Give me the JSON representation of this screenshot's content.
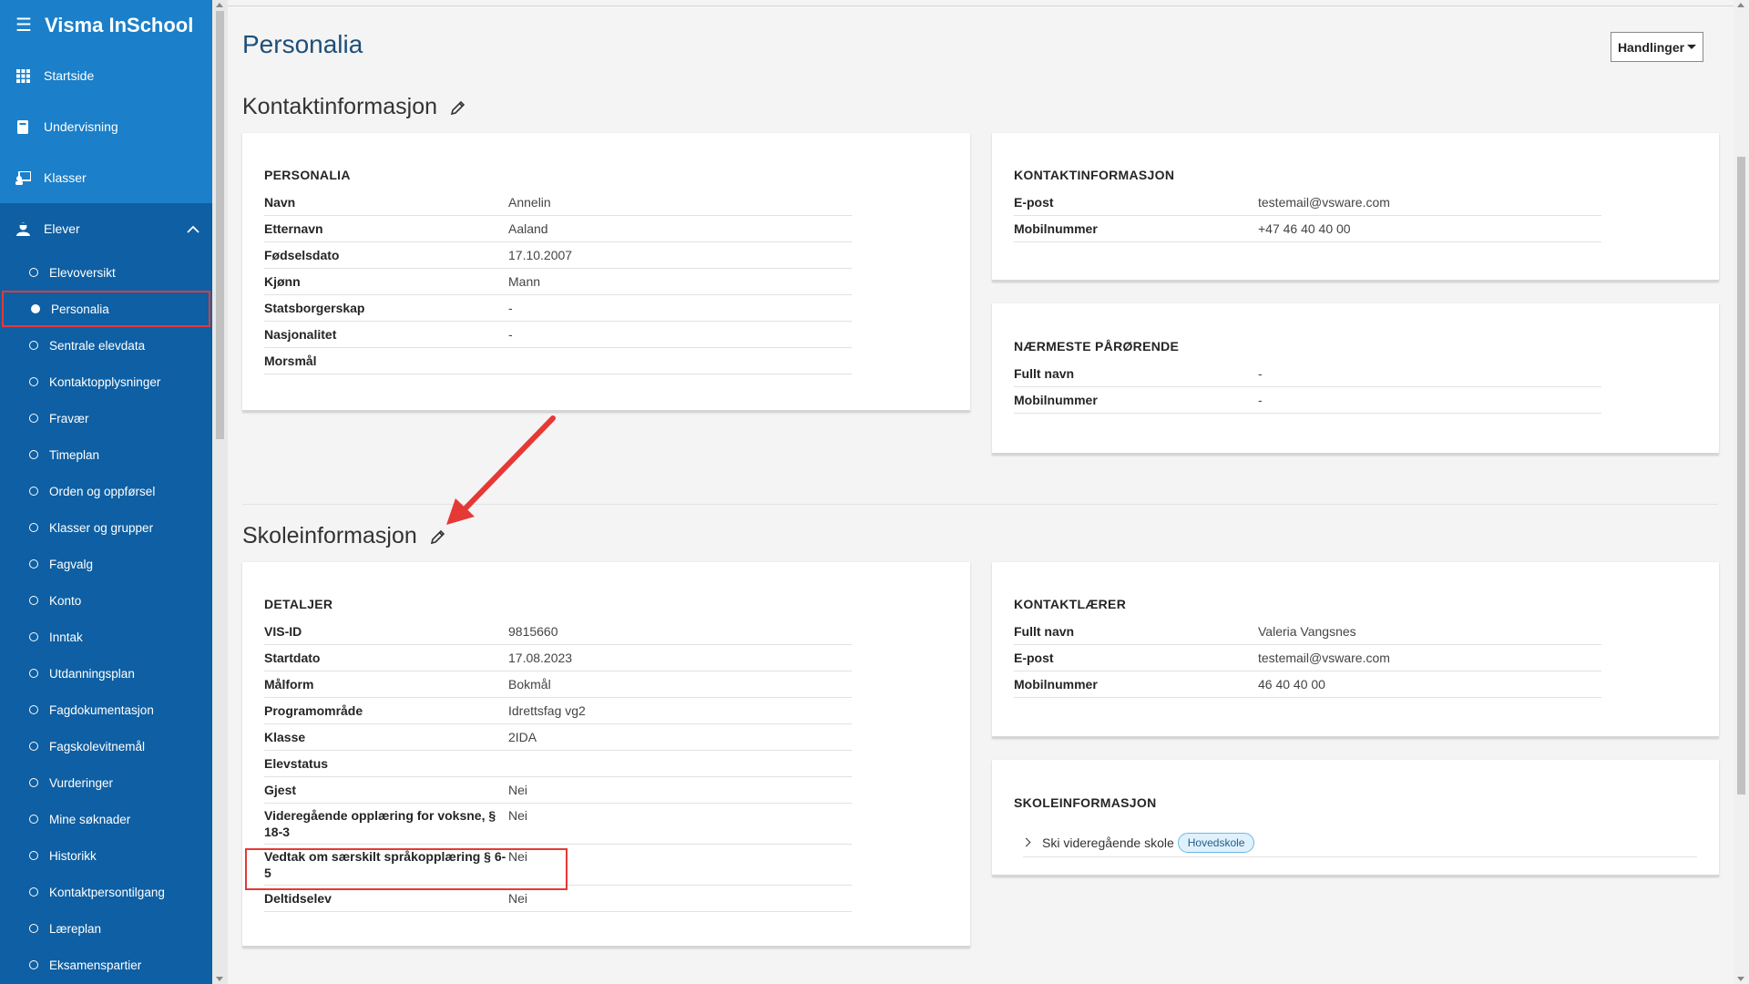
{
  "app": {
    "title": "Visma InSchool"
  },
  "sidebar": {
    "main_items": [
      {
        "label": "Startside",
        "icon": "grid-icon"
      },
      {
        "label": "Undervisning",
        "icon": "book-icon"
      },
      {
        "label": "Klasser",
        "icon": "classroom-icon"
      },
      {
        "label": "Elever",
        "icon": "student-icon"
      }
    ],
    "elever_subitems": [
      "Elevoversikt",
      "Personalia",
      "Sentrale elevdata",
      "Kontaktopplysninger",
      "Fravær",
      "Timeplan",
      "Orden og oppførsel",
      "Klasser og grupper",
      "Fagvalg",
      "Konto",
      "Inntak",
      "Utdanningsplan",
      "Fagdokumentasjon",
      "Fagskolevitnemål",
      "Vurderinger",
      "Mine søknader",
      "Historikk",
      "Kontaktpersontilgang",
      "Læreplan",
      "Eksamenspartier"
    ],
    "active_item": "Personalia"
  },
  "header": {
    "title": "Personalia",
    "actions_label": "Handlinger"
  },
  "kontakt_section": {
    "title": "Kontaktinformasjon",
    "personalia": {
      "heading": "PERSONALIA",
      "rows": [
        {
          "k": "Navn",
          "v": "Annelin"
        },
        {
          "k": "Etternavn",
          "v": "Aaland"
        },
        {
          "k": "Fødselsdato",
          "v": "17.10.2007"
        },
        {
          "k": "Kjønn",
          "v": "Mann"
        },
        {
          "k": "Statsborgerskap",
          "v": "-"
        },
        {
          "k": "Nasjonalitet",
          "v": "-"
        },
        {
          "k": "Morsmål",
          "v": ""
        }
      ]
    },
    "kontaktinfo": {
      "heading": "KONTAKTINFORMASJON",
      "rows": [
        {
          "k": "E-post",
          "v": "testemail@vsware.com"
        },
        {
          "k": "Mobilnummer",
          "v": "+47 46 40 40 00"
        }
      ]
    },
    "parorende": {
      "heading": "NÆRMESTE PÅRØRENDE",
      "rows": [
        {
          "k": "Fullt navn",
          "v": "-"
        },
        {
          "k": "Mobilnummer",
          "v": "-"
        }
      ]
    }
  },
  "skole_section": {
    "title": "Skoleinformasjon",
    "detaljer": {
      "heading": "DETALJER",
      "rows": [
        {
          "k": "VIS-ID",
          "v": "9815660"
        },
        {
          "k": "Startdato",
          "v": "17.08.2023"
        },
        {
          "k": "Målform",
          "v": "Bokmål"
        },
        {
          "k": "Programområde",
          "v": "Idrettsfag vg2"
        },
        {
          "k": "Klasse",
          "v": "2IDA"
        },
        {
          "k": "Elevstatus",
          "v": ""
        },
        {
          "k": "Gjest",
          "v": "Nei"
        },
        {
          "k": "Videregående opplæring for voksne, § 18-3",
          "v": "Nei"
        },
        {
          "k": "Vedtak om særskilt språkopplæring § 6-5",
          "v": "Nei"
        },
        {
          "k": "Deltidselev",
          "v": "Nei"
        }
      ]
    },
    "kontaktlaerer": {
      "heading": "KONTAKTLÆRER",
      "rows": [
        {
          "k": "Fullt navn",
          "v": "Valeria Vangsnes"
        },
        {
          "k": "E-post",
          "v": "testemail@vsware.com"
        },
        {
          "k": "Mobilnummer",
          "v": "46 40 40 00"
        }
      ]
    },
    "skoleinfo": {
      "heading": "SKOLEINFORMASJON",
      "school_name": "Ski videregående skole",
      "badge": "Hovedskole"
    }
  },
  "colors": {
    "sidebar": "#1b7fc9",
    "sidebar_expanded": "#0e5fa3",
    "title": "#1d4f7a",
    "annotation": "#e53935"
  }
}
